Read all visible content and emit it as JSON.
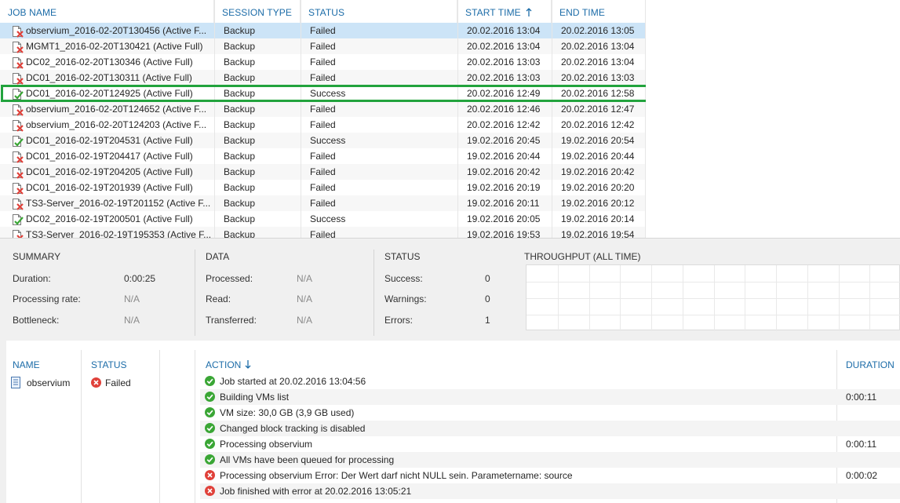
{
  "sessions": {
    "columns": {
      "job_name": "JOB NAME",
      "session_type": "SESSION TYPE",
      "status": "STATUS",
      "start_time": "START TIME",
      "end_time": "END TIME"
    },
    "rows": [
      {
        "name": "observium_2016-02-20T130456 (Active F...",
        "type": "Backup",
        "status": "Failed",
        "start": "20.02.2016 13:04",
        "end": "20.02.2016 13:05",
        "result": "failed",
        "selected": true
      },
      {
        "name": "MGMT1_2016-02-20T130421 (Active Full)",
        "type": "Backup",
        "status": "Failed",
        "start": "20.02.2016 13:04",
        "end": "20.02.2016 13:04",
        "result": "failed"
      },
      {
        "name": "DC02_2016-02-20T130346 (Active Full)",
        "type": "Backup",
        "status": "Failed",
        "start": "20.02.2016 13:03",
        "end": "20.02.2016 13:04",
        "result": "failed"
      },
      {
        "name": "DC01_2016-02-20T130311 (Active Full)",
        "type": "Backup",
        "status": "Failed",
        "start": "20.02.2016 13:03",
        "end": "20.02.2016 13:03",
        "result": "failed"
      },
      {
        "name": "DC01_2016-02-20T124925 (Active Full)",
        "type": "Backup",
        "status": "Success",
        "start": "20.02.2016 12:49",
        "end": "20.02.2016 12:58",
        "result": "success",
        "highlighted": true
      },
      {
        "name": "observium_2016-02-20T124652 (Active F...",
        "type": "Backup",
        "status": "Failed",
        "start": "20.02.2016 12:46",
        "end": "20.02.2016 12:47",
        "result": "failed"
      },
      {
        "name": "observium_2016-02-20T124203 (Active F...",
        "type": "Backup",
        "status": "Failed",
        "start": "20.02.2016 12:42",
        "end": "20.02.2016 12:42",
        "result": "failed"
      },
      {
        "name": "DC01_2016-02-19T204531 (Active Full)",
        "type": "Backup",
        "status": "Success",
        "start": "19.02.2016 20:45",
        "end": "19.02.2016 20:54",
        "result": "success"
      },
      {
        "name": "DC01_2016-02-19T204417 (Active Full)",
        "type": "Backup",
        "status": "Failed",
        "start": "19.02.2016 20:44",
        "end": "19.02.2016 20:44",
        "result": "failed"
      },
      {
        "name": "DC01_2016-02-19T204205 (Active Full)",
        "type": "Backup",
        "status": "Failed",
        "start": "19.02.2016 20:42",
        "end": "19.02.2016 20:42",
        "result": "failed"
      },
      {
        "name": "DC01_2016-02-19T201939 (Active Full)",
        "type": "Backup",
        "status": "Failed",
        "start": "19.02.2016 20:19",
        "end": "19.02.2016 20:20",
        "result": "failed"
      },
      {
        "name": "TS3-Server_2016-02-19T201152 (Active F...",
        "type": "Backup",
        "status": "Failed",
        "start": "19.02.2016 20:11",
        "end": "19.02.2016 20:12",
        "result": "failed"
      },
      {
        "name": "DC02_2016-02-19T200501 (Active Full)",
        "type": "Backup",
        "status": "Success",
        "start": "19.02.2016 20:05",
        "end": "19.02.2016 20:14",
        "result": "success"
      },
      {
        "name": "TS3-Server_2016-02-19T195353 (Active F...",
        "type": "Backup",
        "status": "Failed",
        "start": "19.02.2016 19:53",
        "end": "19.02.2016 19:54",
        "result": "failed"
      }
    ]
  },
  "summary": {
    "title": "SUMMARY",
    "duration_label": "Duration:",
    "duration": "0:00:25",
    "rate_label": "Processing rate:",
    "rate": "N/A",
    "bottleneck_label": "Bottleneck:",
    "bottleneck": "N/A"
  },
  "data_section": {
    "title": "DATA",
    "processed_label": "Processed:",
    "processed": "N/A",
    "read_label": "Read:",
    "read": "N/A",
    "transferred_label": "Transferred:",
    "transferred": "N/A"
  },
  "status_section": {
    "title": "STATUS",
    "success_label": "Success:",
    "success": "0",
    "warnings_label": "Warnings:",
    "warnings": "0",
    "errors_label": "Errors:",
    "errors": "1"
  },
  "throughput": {
    "title": "THROUGHPUT (ALL TIME)"
  },
  "detail": {
    "name_header": "NAME",
    "status_header": "STATUS",
    "action_header": "ACTION",
    "duration_header": "DURATION",
    "vm": {
      "name": "observium",
      "status": "Failed"
    },
    "actions": [
      {
        "text": "Job started at 20.02.2016 13:04:56",
        "duration": "",
        "result": "ok"
      },
      {
        "text": "Building VMs list",
        "duration": "0:00:11",
        "result": "ok"
      },
      {
        "text": "VM size: 30,0 GB (3,9 GB used)",
        "duration": "",
        "result": "ok"
      },
      {
        "text": "Changed block tracking is disabled",
        "duration": "",
        "result": "ok"
      },
      {
        "text": "Processing observium",
        "duration": "0:00:11",
        "result": "ok"
      },
      {
        "text": "All VMs have been queued for processing",
        "duration": "",
        "result": "ok"
      },
      {
        "text": "Processing observium Error: Der Wert darf nicht NULL sein. Parametername: source",
        "duration": "0:00:02",
        "result": "error"
      },
      {
        "text": "Job finished with error at 20.02.2016 13:05:21",
        "duration": "",
        "result": "error"
      }
    ]
  },
  "colors": {
    "accent": "#1c6ca8",
    "selected_row": "#cce4f7",
    "highlight": "#22a33d",
    "ok": "#3aa635",
    "error": "#e0413a"
  },
  "icons": {
    "failed": "job-failed-icon",
    "success": "job-success-icon",
    "ok": "check-circle-icon",
    "error": "error-circle-icon"
  }
}
